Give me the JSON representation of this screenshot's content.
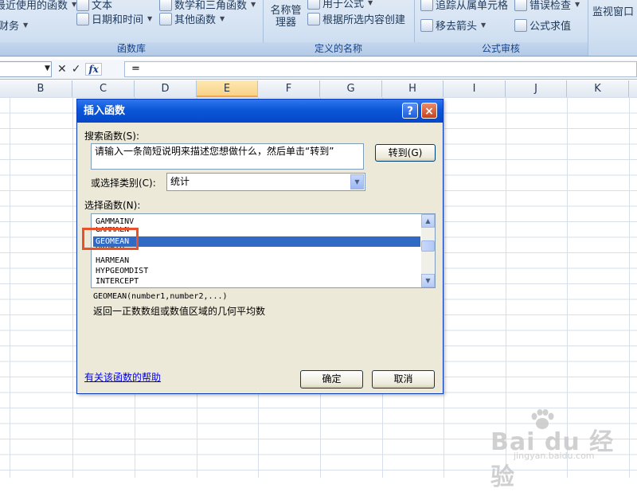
{
  "ribbon": {
    "groups": [
      {
        "label": "函数库",
        "items": [
          "最近使用的函数",
          "文本",
          "日期和时间",
          "数学和三角函数",
          "其他函数",
          "财务"
        ]
      },
      {
        "label": "定义的名称",
        "items": [
          "名称管理器",
          "用于公式",
          "根据所选内容创建"
        ]
      },
      {
        "label": "公式审核",
        "items": [
          "追踪从属单元格",
          "错误检查",
          "移去箭头",
          "公式求值"
        ]
      },
      {
        "label": "",
        "items": [
          "监视窗口"
        ]
      }
    ]
  },
  "formula_bar": {
    "fx": "fx",
    "value": "="
  },
  "columns": [
    "B",
    "C",
    "D",
    "E",
    "F",
    "G",
    "H",
    "I",
    "J",
    "K"
  ],
  "dialog": {
    "title": "插入函数",
    "help_button": "?",
    "close_button": "×",
    "search_label": "搜索函数(S):",
    "search_value": "请输入一条简短说明来描述您想做什么，然后单击“转到”",
    "go_button": "转到(G)",
    "category_label": "或选择类别(C):",
    "category_value": "统计",
    "function_list_label": "选择函数(N):",
    "functions": [
      "GAMMAINV",
      "GAMMALN",
      "GEOMEAN",
      "GROWTH",
      "HARMEAN",
      "HYPGEOMDIST",
      "INTERCEPT"
    ],
    "selected_function": "GEOMEAN",
    "signature": "GEOMEAN(number1,number2,...)",
    "description": "返回一正数数组或数值区域的几何平均数",
    "help_link": "有关该函数的帮助",
    "ok_button": "确定",
    "cancel_button": "取消"
  },
  "watermark": {
    "brand": "Bai du 经验",
    "url": "jingyan.baidu.com"
  },
  "colors": {
    "titlebar": "#0b56d8",
    "selection": "#316ac5",
    "highlight": "#e8512a",
    "dialog_bg": "#ece9d8"
  }
}
